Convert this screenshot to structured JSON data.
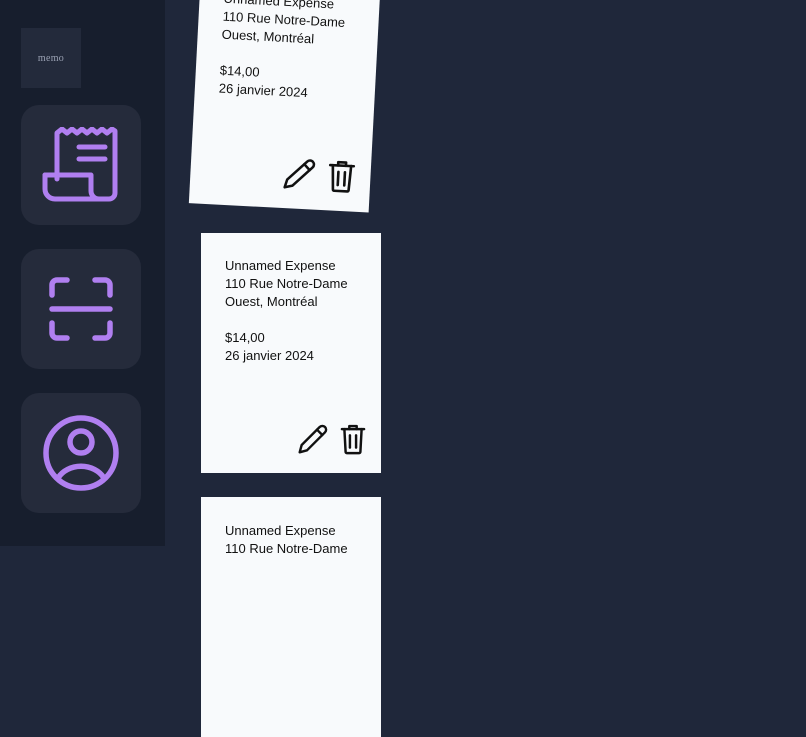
{
  "logo": {
    "text": "memo"
  },
  "nav": {
    "receipts": {
      "icon": "receipt-icon"
    },
    "scan": {
      "icon": "scan-icon"
    },
    "profile": {
      "icon": "user-circle-icon"
    }
  },
  "accent_color": "#b07ff0",
  "expenses": [
    {
      "name": "Unnamed Expense",
      "address_line1": "110 Rue Notre-Dame",
      "address_line2": "Ouest, Montréal",
      "amount": "$14,00",
      "date": "26 janvier 2024"
    },
    {
      "name": "Unnamed Expense",
      "address_line1": "110 Rue Notre-Dame",
      "address_line2": "Ouest, Montréal",
      "amount": "$14,00",
      "date": "26 janvier 2024"
    },
    {
      "name": "Unnamed Expense",
      "address_line1": "110 Rue Notre-Dame",
      "address_line2": "",
      "amount": "",
      "date": ""
    }
  ]
}
